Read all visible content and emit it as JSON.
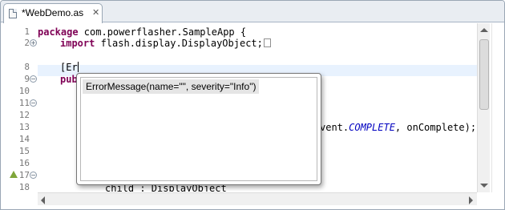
{
  "tab": {
    "title": "*WebDemo.as",
    "icon": "actionscript-file-icon",
    "close_icon": "close-icon",
    "close_glyph": "✕"
  },
  "gutter": {
    "line_numbers": [
      "1",
      "2",
      "8",
      "9",
      "10",
      "11",
      "12",
      "13",
      "14",
      "15",
      "16",
      "17",
      "18"
    ]
  },
  "code": {
    "line1_kw": "package",
    "line1_rest": " com.powerflasher.SampleApp {",
    "line2_kw": "import",
    "line2_rest": " flash.display.DisplayObject;",
    "line8_text": "[Er",
    "line9_kw": "pub",
    "line13_tail_a": "vent.",
    "line13_const": "COMPLETE",
    "line13_tail_b": ", onComplete);",
    "line18_text": "child : DisplayObject"
  },
  "autocomplete": {
    "items": [
      "ErrorMessage(name=\"\", severity=\"Info\")"
    ],
    "selected_index": 0
  },
  "colors": {
    "keyword": "#7f0055",
    "constant": "#0000c0",
    "current_line": "#e8f2fe",
    "line_number": "#787878"
  }
}
